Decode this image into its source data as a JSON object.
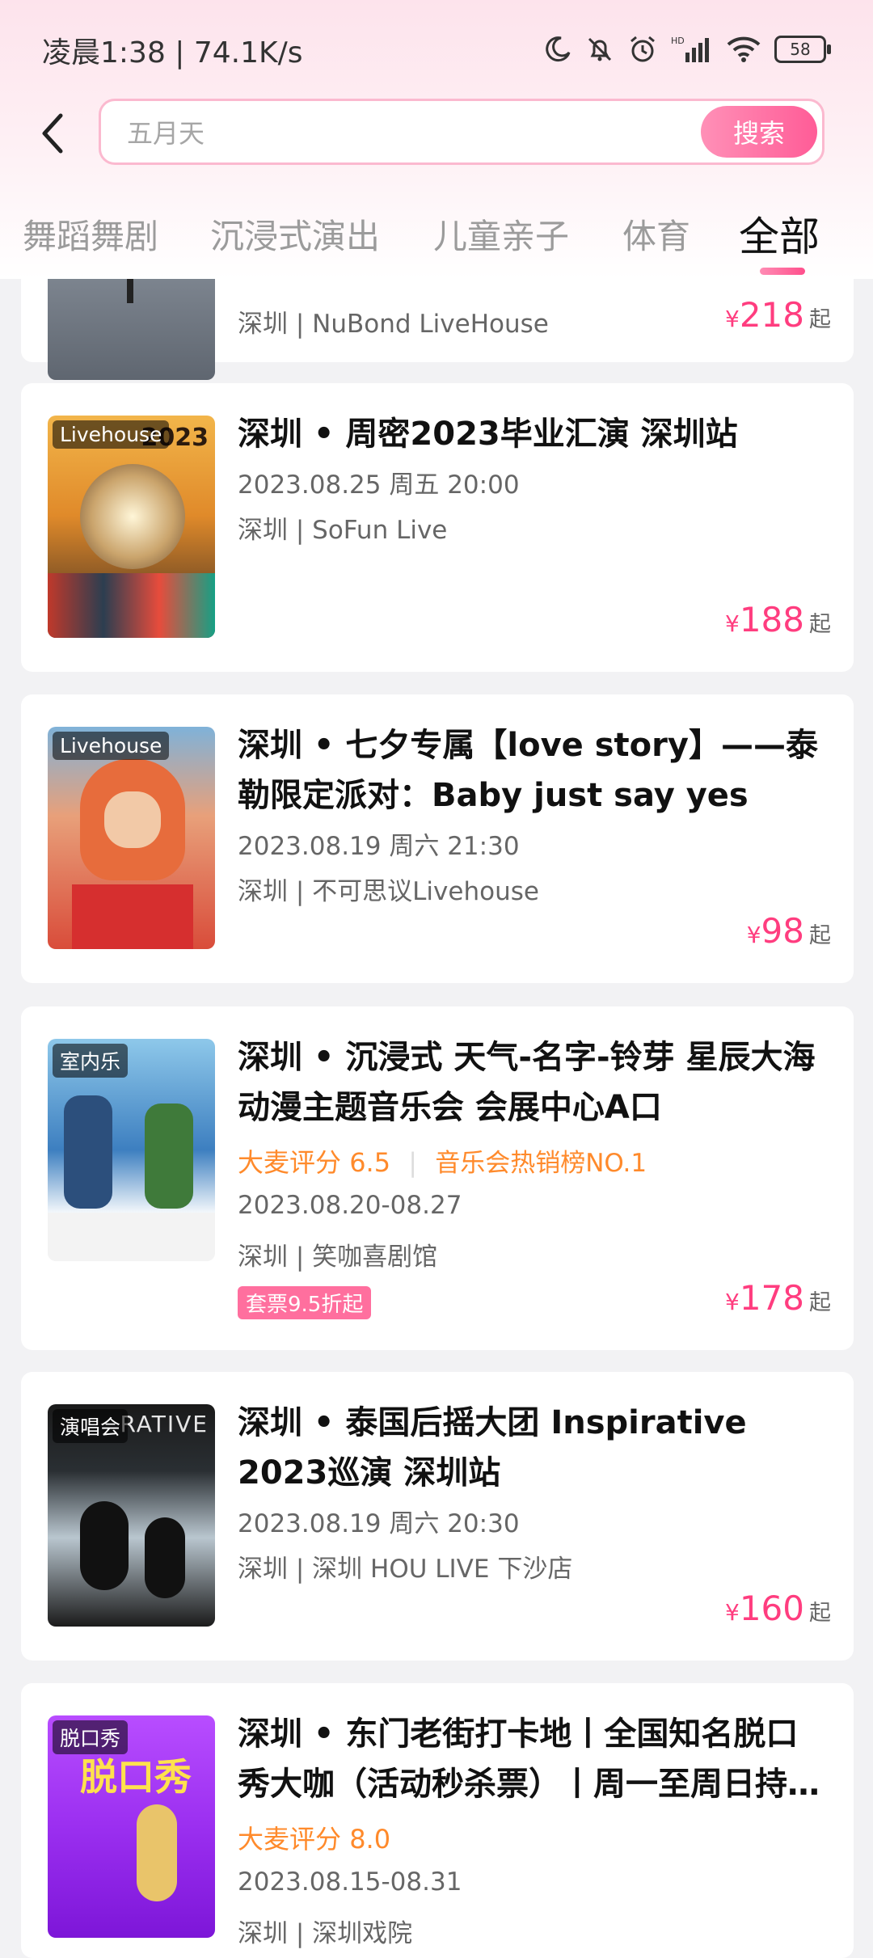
{
  "status_bar": {
    "time": "凌晨1:38 | 74.1K/s",
    "battery": "58",
    "icons": [
      "moon-icon",
      "bell-off-icon",
      "alarm-icon",
      "signal-icon",
      "wifi-icon",
      "battery-icon"
    ]
  },
  "header": {
    "back_icon": "back-arrow-icon",
    "search_placeholder": "五月天",
    "search_button": "搜索"
  },
  "tabs": [
    {
      "label": "舞蹈舞剧"
    },
    {
      "label": "沉浸式演出"
    },
    {
      "label": "儿童亲子"
    },
    {
      "label": "体育"
    },
    {
      "label": "全部",
      "active": true
    }
  ],
  "events": [
    {
      "venue": "深圳 | NuBond LiveHouse",
      "price": "218",
      "currency": "¥",
      "suffix": "起"
    },
    {
      "tag": "Livehouse",
      "title": "深圳 • 周密2023毕业汇演 深圳站",
      "date": "2023.08.25 周五 20:00",
      "venue": "深圳 | SoFun Live",
      "price": "188",
      "currency": "¥",
      "suffix": "起"
    },
    {
      "tag": "Livehouse",
      "title": "深圳 • 七夕专属【love story】——泰勒限定派对：Baby just say yes",
      "date": "2023.08.19 周六 21:30",
      "venue": "深圳 | 不可思议Livehouse",
      "price": "98",
      "currency": "¥",
      "suffix": "起"
    },
    {
      "tag": "室内乐",
      "title": "深圳 • 沉浸式 天气-名字-铃芽 星辰大海动漫主题音乐会  会展中心A口",
      "rating_label": "大麦评分",
      "rating_value": "6.5",
      "rank": "音乐会热销榜NO.1",
      "date": "2023.08.20-08.27",
      "venue": "深圳 | 笑咖喜剧馆",
      "badge": "套票9.5折起",
      "price": "178",
      "currency": "¥",
      "suffix": "起"
    },
    {
      "tag": "演唱会",
      "title": "深圳 • 泰国后摇大团 Inspirative 2023巡演 深圳站",
      "date": "2023.08.19 周六 20:30",
      "venue": "深圳 | 深圳 HOU LIVE 下沙店",
      "price": "160",
      "currency": "¥",
      "suffix": "起"
    },
    {
      "tag": "脱口秀",
      "title": "深圳 • 东门老街打卡地丨全国知名脱口秀大咖（活动秒杀票）丨周一至周日持…",
      "rating_label": "大麦评分",
      "rating_value": "8.0",
      "date": "2023.08.15-08.31",
      "venue": "深圳 | 深圳戏院"
    }
  ],
  "posters": {
    "p2_text": "2023",
    "p5_text": "RATIVE",
    "p6_text": "脱口秀"
  },
  "colors": {
    "accent": "#ff3d7f",
    "rating": "#ff8a2b",
    "search_border": "#fbb9cf"
  }
}
